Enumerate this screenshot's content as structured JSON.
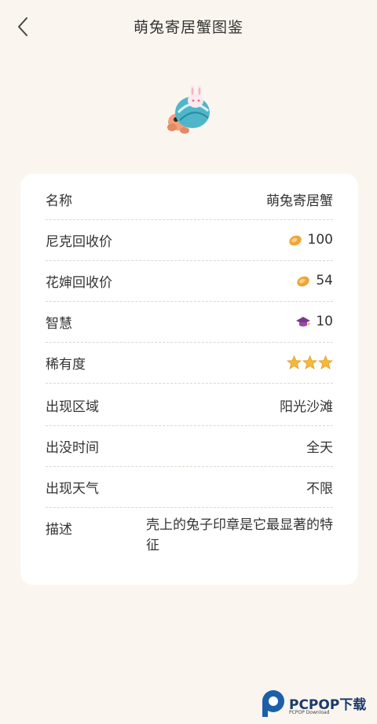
{
  "header": {
    "title": "萌兔寄居蟹图鉴"
  },
  "rows": [
    {
      "label": "名称",
      "value": "萌兔寄居蟹"
    },
    {
      "label": "尼克回收价",
      "value": "100",
      "icon": "shell-coin-icon"
    },
    {
      "label": "花婶回收价",
      "value": "54",
      "icon": "shell-coin-icon"
    },
    {
      "label": "智慧",
      "value": "10",
      "icon": "graduation-cap-icon"
    },
    {
      "label": "稀有度",
      "stars": 3
    },
    {
      "label": "出现区域",
      "value": "阳光沙滩"
    },
    {
      "label": "出没时间",
      "value": "全天"
    },
    {
      "label": "出现天气",
      "value": "不限"
    },
    {
      "label": "描述",
      "value": "壳上的兔子印章是它最显著的特征"
    }
  ],
  "watermark": {
    "text": "PCPOP下载",
    "sub": "PCPOP Download"
  },
  "colors": {
    "background": "#faf5ef",
    "card": "#ffffff",
    "star": "#f5b83a",
    "coin": "#f0a33a",
    "cap": "#7a3a8a"
  }
}
